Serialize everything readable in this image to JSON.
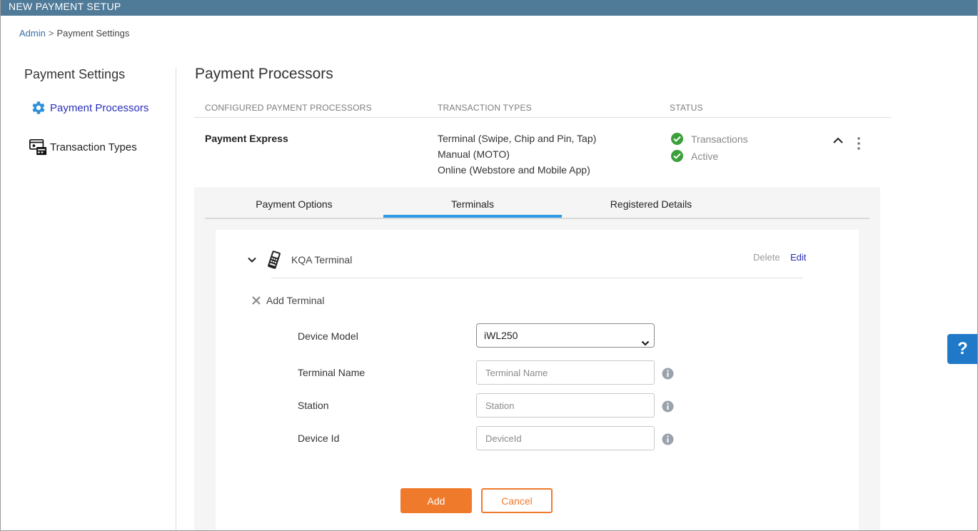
{
  "window": {
    "title": "NEW PAYMENT SETUP"
  },
  "breadcrumb": {
    "root": "Admin",
    "separator": ">",
    "current": "Payment Settings"
  },
  "sidebar": {
    "title": "Payment Settings",
    "items": [
      {
        "label": "Payment Processors",
        "icon": "gear-icon",
        "active": true
      },
      {
        "label": "Transaction Types",
        "icon": "card-reader-icon",
        "active": false
      }
    ]
  },
  "main": {
    "title": "Payment Processors",
    "columns": [
      "CONFIGURED PAYMENT PROCESSORS",
      "TRANSACTION TYPES",
      "STATUS"
    ],
    "processor": {
      "name": "Payment Express",
      "transaction_types": [
        "Terminal (Swipe, Chip and Pin, Tap)",
        "Manual (MOTO)",
        "Online (Webstore and Mobile App)"
      ],
      "statuses": [
        "Transactions",
        "Active"
      ]
    },
    "tabs": [
      {
        "label": "Payment Options",
        "active": false
      },
      {
        "label": "Terminals",
        "active": true
      },
      {
        "label": "Registered Details",
        "active": false
      }
    ],
    "terminal": {
      "name": "KQA Terminal",
      "delete_label": "Delete",
      "edit_label": "Edit"
    },
    "add_terminal": {
      "title": "Add Terminal",
      "device_model_label": "Device Model",
      "device_model_value": "iWL250",
      "terminal_name_label": "Terminal Name",
      "terminal_name_placeholder": "Terminal Name",
      "station_label": "Station",
      "station_placeholder": "Station",
      "device_id_label": "Device Id",
      "device_id_placeholder": "DeviceId",
      "add_label": "Add",
      "cancel_label": "Cancel"
    }
  },
  "help": {
    "label": "?"
  },
  "colors": {
    "accent": "#2e9be6",
    "primary_button": "#f07a2c",
    "topbar": "#4f7a98",
    "success": "#3aa03a",
    "link": "#2a2fb8"
  }
}
